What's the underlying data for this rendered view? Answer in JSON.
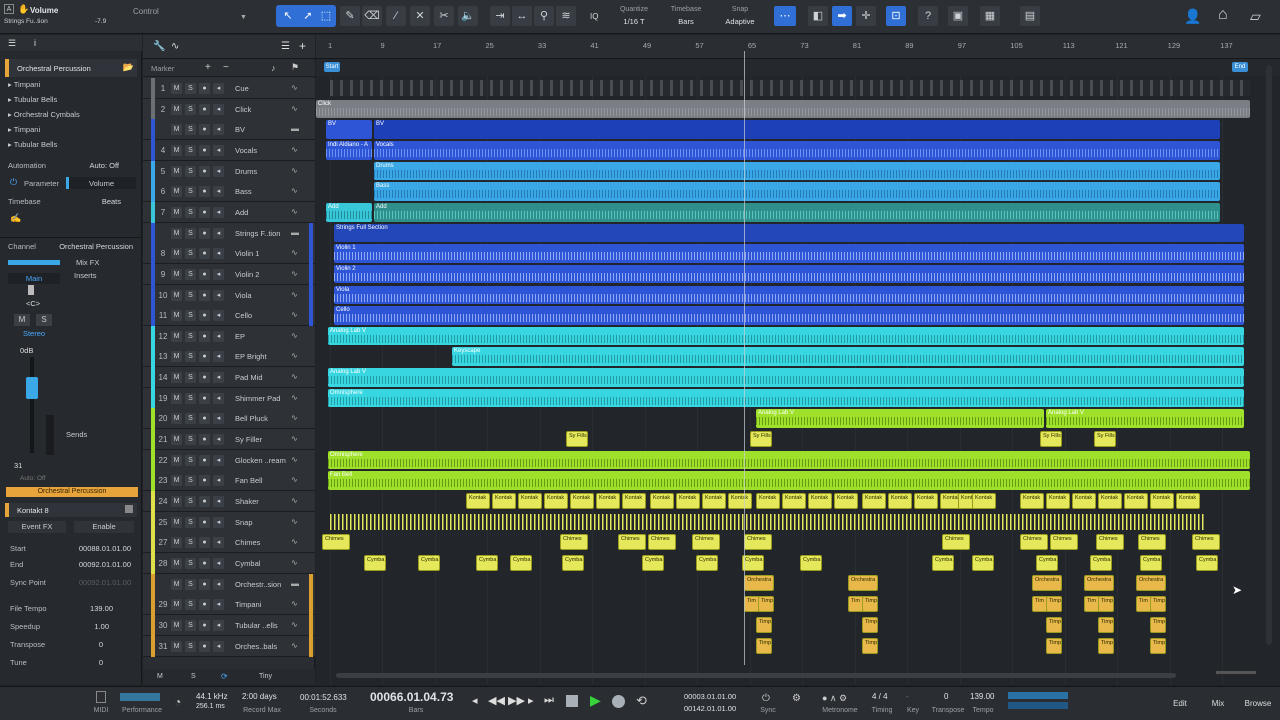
{
  "toolbar": {
    "volume_label": "Volume",
    "volume_value": "-7.9",
    "control_label": "Control",
    "track_name": "Strings Fu..tion",
    "quantize_label": "Quantize",
    "quantize_value": "1/16 T",
    "timebase_label": "Timebase",
    "timebase_value": "Bars",
    "snap_label": "Snap",
    "snap_value": "Adaptive",
    "iq_label": "IQ",
    "help_label": "?"
  },
  "inspector": {
    "instrument_name": "Orchestral Percussion",
    "instruments": [
      "Timpani",
      "Tubular Bells",
      "Orchestral Cymbals",
      "Timpani",
      "Tubular Bells"
    ],
    "automation_label": "Automation",
    "automation_value": "Auto: Off",
    "parameter_label": "Parameter",
    "parameter_value": "Volume",
    "timebase_label": "Timebase",
    "timebase_value": "Beats",
    "channel_label": "Channel",
    "channel_value": "Orchestral Percussion",
    "mixfx_label": "Mix FX",
    "main_label": "Main",
    "inserts_label": "Inserts",
    "pan_label": "<C>",
    "mute_label": "M",
    "solo_label": "S",
    "stereo_label": "Stereo",
    "db_label": "0dB",
    "sends_label": "Sends",
    "channel_number": "31",
    "auto_off": "Auto: Off",
    "channel_strip_name": "Orchestral Percussion",
    "plugin_name": "Kontakt 8",
    "eventfx_label": "Event FX",
    "enable_label": "Enable",
    "start_label": "Start",
    "start_value": "00088.01.01.00",
    "end_label": "End",
    "end_value": "00092.01.01.00",
    "syncpoint_label": "Sync Point",
    "syncpoint_value": "00092.01.01.00",
    "filetempo_label": "File Tempo",
    "filetempo_value": "139.00",
    "speedup_label": "Speedup",
    "speedup_value": "1.00",
    "transpose_label": "Transpose",
    "transpose_value": "0",
    "tune_label": "Tune",
    "tune_value": "0"
  },
  "tracklist": {
    "marker_label": "Marker",
    "tracks": [
      {
        "num": "1",
        "name": "Cue",
        "color": "#6b7077"
      },
      {
        "num": "2",
        "name": "Click",
        "color": "#6b7077"
      },
      {
        "num": "",
        "name": "BV",
        "color": "#2d55d6"
      },
      {
        "num": "4",
        "name": "Vocals",
        "color": "#2d55d6"
      },
      {
        "num": "5",
        "name": "Drums",
        "color": "#3aa8e6"
      },
      {
        "num": "6",
        "name": "Bass",
        "color": "#3aa8e6"
      },
      {
        "num": "7",
        "name": "Add",
        "color": "#37c7d8"
      },
      {
        "num": "",
        "name": "Strings F..tion",
        "color": "#2d55d6"
      },
      {
        "num": "8",
        "name": "Violin 1",
        "color": "#2d55d6"
      },
      {
        "num": "9",
        "name": "Violin 2",
        "color": "#2d55d6"
      },
      {
        "num": "10",
        "name": "Viola",
        "color": "#2d55d6"
      },
      {
        "num": "11",
        "name": "Cello",
        "color": "#2d55d6"
      },
      {
        "num": "12",
        "name": "EP",
        "color": "#37d6e0"
      },
      {
        "num": "13",
        "name": "EP Bright",
        "color": "#37d6e0"
      },
      {
        "num": "14",
        "name": "Pad Mid",
        "color": "#37d6e0"
      },
      {
        "num": "19",
        "name": "Shimmer Pad",
        "color": "#37d6e0"
      },
      {
        "num": "20",
        "name": "Bell Pluck",
        "color": "#9ee02a"
      },
      {
        "num": "21",
        "name": "Sy Filler",
        "color": "#9ee02a"
      },
      {
        "num": "22",
        "name": "Glocken ..ream",
        "color": "#9ee02a"
      },
      {
        "num": "23",
        "name": "Fan Bell",
        "color": "#9ee02a"
      },
      {
        "num": "24",
        "name": "Shaker",
        "color": "#e0e04a"
      },
      {
        "num": "25",
        "name": "Snap",
        "color": "#e0e04a"
      },
      {
        "num": "27",
        "name": "Chimes",
        "color": "#e0e04a"
      },
      {
        "num": "28",
        "name": "Cymbal",
        "color": "#e0e04a"
      },
      {
        "num": "",
        "name": "Orchestr..sion",
        "color": "#d9a030"
      },
      {
        "num": "29",
        "name": "Timpani",
        "color": "#d9a030"
      },
      {
        "num": "30",
        "name": "Tubular ..ells",
        "color": "#d9a030"
      },
      {
        "num": "31",
        "name": "Orches..bals",
        "color": "#d9a030"
      }
    ]
  },
  "ruler": {
    "bars": [
      "1",
      "9",
      "17",
      "25",
      "33",
      "41",
      "49",
      "57",
      "65",
      "73",
      "81",
      "89",
      "97",
      "105",
      "113",
      "121",
      "129",
      "137"
    ],
    "start_marker": "Start",
    "end_marker": "End"
  },
  "clips": {
    "click": "Click",
    "bv1": "BV",
    "bv2": "BV",
    "vocals1": "Indi Aldiano - A",
    "vocals2": "Vocals",
    "drums": "Drums",
    "bass": "Bass",
    "add1": "Add",
    "add2": "Add",
    "strings": "Strings Full Section",
    "violin1": "Violin 1",
    "violin2": "Violin 2",
    "viola": "Viola",
    "cello": "Cello",
    "ep": "Analog Lab V",
    "epbright": "Keyscape",
    "padmid": "Analog Lab V",
    "shimmer": "Omnisphere",
    "bellpluck1": "Analog Lab V",
    "bellpluck2": "Analog Lab V",
    "syfill": "Sy Fills",
    "glocken": "Omnisphere",
    "fanbell": "Fan Bell",
    "kontakt": "Kontak",
    "chimes": "Chimes",
    "cymbal": "Cymba",
    "orchestra": "Orchestra",
    "timp": "Timp",
    "tim": "Tim"
  },
  "transport": {
    "midi_label": "MIDI",
    "performance_label": "Performance",
    "samplerate": "44.1 kHz",
    "latency": "256.1 ms",
    "record_days": "2:00 days",
    "record_max_label": "Record Max",
    "seconds_value": "00:01:52.633",
    "seconds_label": "Seconds",
    "bars_value": "00066.01.04.73",
    "bars_label": "Bars",
    "loop_start": "00003.01.01.00",
    "loop_end": "00142.01.01.00",
    "sync_label": "Sync",
    "metronome_label": "Metronome",
    "timing_label": "Timing",
    "timesig": "4 / 4",
    "key_label": "Key",
    "transpose_label": "Transpose",
    "transpose_value": "0",
    "tempo_label": "Tempo",
    "tempo_value": "139.00",
    "edit_label": "Edit",
    "mix_label": "Mix",
    "browse_label": "Browse",
    "zoom_label": "Tiny",
    "m_label": "M",
    "s_label": "S"
  }
}
